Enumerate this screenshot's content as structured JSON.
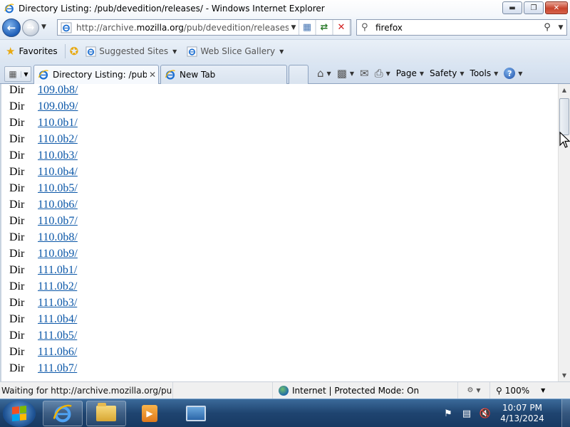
{
  "window": {
    "title": "Directory Listing: /pub/devedition/releases/ - Windows Internet Explorer",
    "minimize_icon": "minimize-icon",
    "maximize_icon": "maximize-icon",
    "close_icon": "close-icon"
  },
  "nav": {
    "url_prefix": "http://archive.",
    "url_domain": "mozilla.org",
    "url_path": "/pub/devedition/releases/",
    "search_value": "firefox"
  },
  "favorites": {
    "label": "Favorites",
    "items": [
      {
        "label": "Suggested Sites"
      },
      {
        "label": "Web Slice Gallery"
      }
    ]
  },
  "tabs": [
    {
      "label": "Directory Listing: /pub/...",
      "active": true
    },
    {
      "label": "New Tab",
      "active": false
    }
  ],
  "commands": {
    "page": "Page",
    "safety": "Safety",
    "tools": "Tools"
  },
  "listing": [
    {
      "kind": "Dir",
      "name": "109.0b8/"
    },
    {
      "kind": "Dir",
      "name": "109.0b9/"
    },
    {
      "kind": "Dir",
      "name": "110.0b1/"
    },
    {
      "kind": "Dir",
      "name": "110.0b2/"
    },
    {
      "kind": "Dir",
      "name": "110.0b3/"
    },
    {
      "kind": "Dir",
      "name": "110.0b4/"
    },
    {
      "kind": "Dir",
      "name": "110.0b5/"
    },
    {
      "kind": "Dir",
      "name": "110.0b6/"
    },
    {
      "kind": "Dir",
      "name": "110.0b7/"
    },
    {
      "kind": "Dir",
      "name": "110.0b8/"
    },
    {
      "kind": "Dir",
      "name": "110.0b9/"
    },
    {
      "kind": "Dir",
      "name": "111.0b1/"
    },
    {
      "kind": "Dir",
      "name": "111.0b2/"
    },
    {
      "kind": "Dir",
      "name": "111.0b3/"
    },
    {
      "kind": "Dir",
      "name": "111.0b4/"
    },
    {
      "kind": "Dir",
      "name": "111.0b5/"
    },
    {
      "kind": "Dir",
      "name": "111.0b6/"
    },
    {
      "kind": "Dir",
      "name": "111.0b7/"
    }
  ],
  "status": {
    "text": "Waiting for http://archive.mozilla.org/pub/de",
    "zone": "Internet | Protected Mode: On",
    "zoom": "100%"
  },
  "taskbar": {
    "time": "10:07 PM",
    "date": "4/13/2024"
  }
}
